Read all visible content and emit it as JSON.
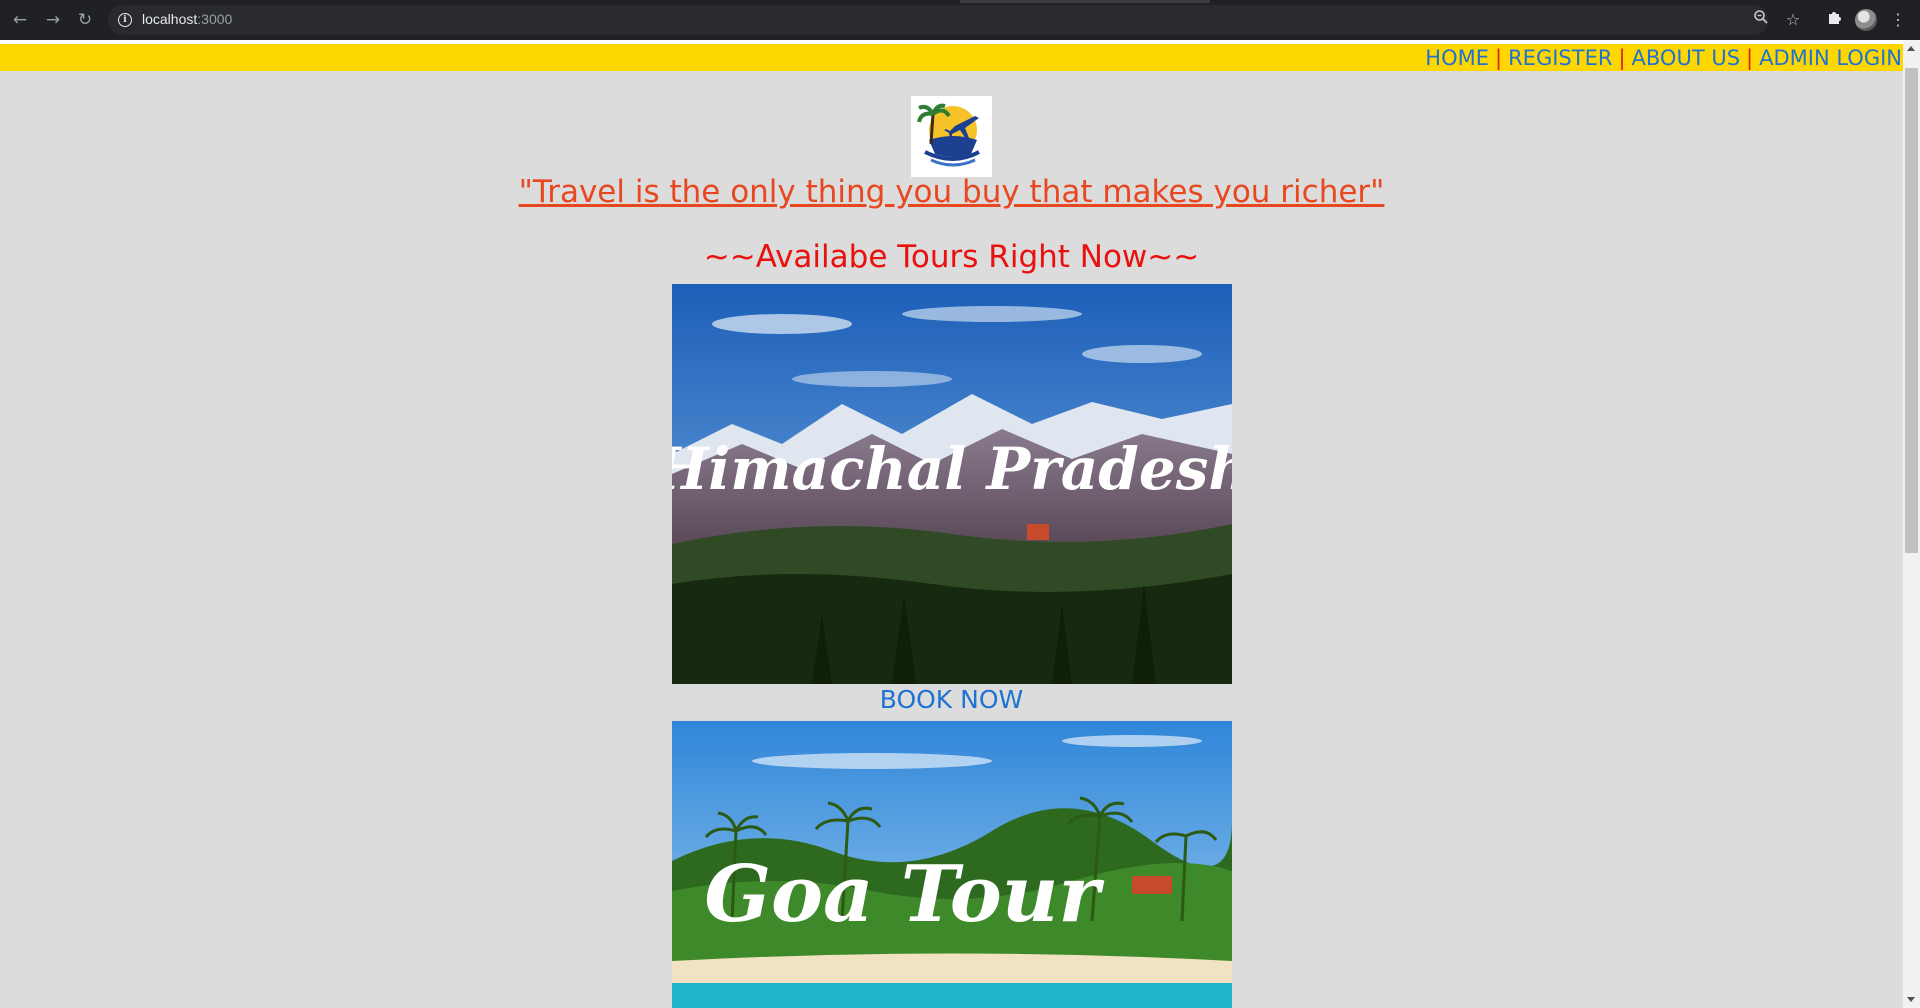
{
  "browser": {
    "url_host": "localhost",
    "url_port": ":3000"
  },
  "nav": {
    "home": "HOME",
    "register": "REGISTER",
    "about": "ABOUT US",
    "admin": "ADMIN LOGIN",
    "separator": "|"
  },
  "page": {
    "quote": "\"Travel is the only thing you buy that makes you richer\"",
    "heading": "~~Availabe Tours Right Now~~"
  },
  "tours": [
    {
      "image_text": "Himachal Pradesh",
      "book_label": "BOOK NOW"
    },
    {
      "image_text": "Goa Tour"
    }
  ],
  "colors": {
    "topbar": "#ffd700",
    "link": "#1e73d2",
    "separator": "#e0201c",
    "quote": "#e8481f",
    "heading": "#e8110e",
    "background": "#dcdcdc"
  },
  "icons": [
    "back-arrow-icon",
    "forward-arrow-icon",
    "reload-icon",
    "info-icon",
    "zoom-icon",
    "star-icon",
    "puzzle-icon",
    "profile-avatar-icon",
    "menu-dots-icon",
    "logo-icon"
  ]
}
